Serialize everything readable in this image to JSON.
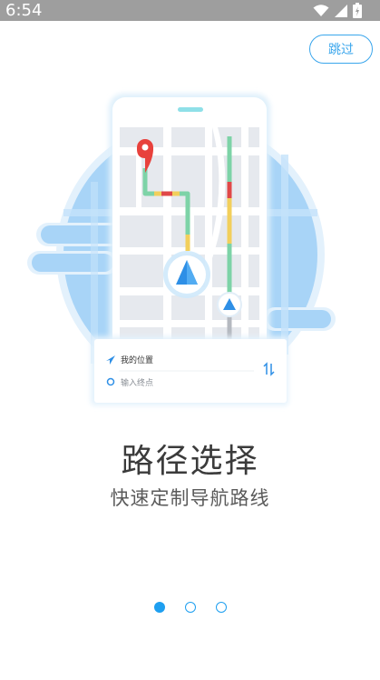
{
  "status_bar": {
    "time": "6:54"
  },
  "skip_label": "跳过",
  "route_card": {
    "origin_label": "我的位置",
    "destination_placeholder": "输入终点"
  },
  "title": "路径选择",
  "subtitle": "快速定制导航路线",
  "pager": {
    "count": 3,
    "active_index": 0
  },
  "colors": {
    "accent": "#1e9ff0",
    "map_blob": "#a8d4f7",
    "route_green": "#7dd3a7",
    "route_yellow": "#f2cf5b",
    "route_red": "#e04848"
  },
  "icons": [
    "wifi-icon",
    "signal-icon",
    "battery-icon",
    "navigation-arrow-icon",
    "location-pin-icon",
    "swap-icon",
    "origin-arrow-icon",
    "destination-circle-icon"
  ]
}
